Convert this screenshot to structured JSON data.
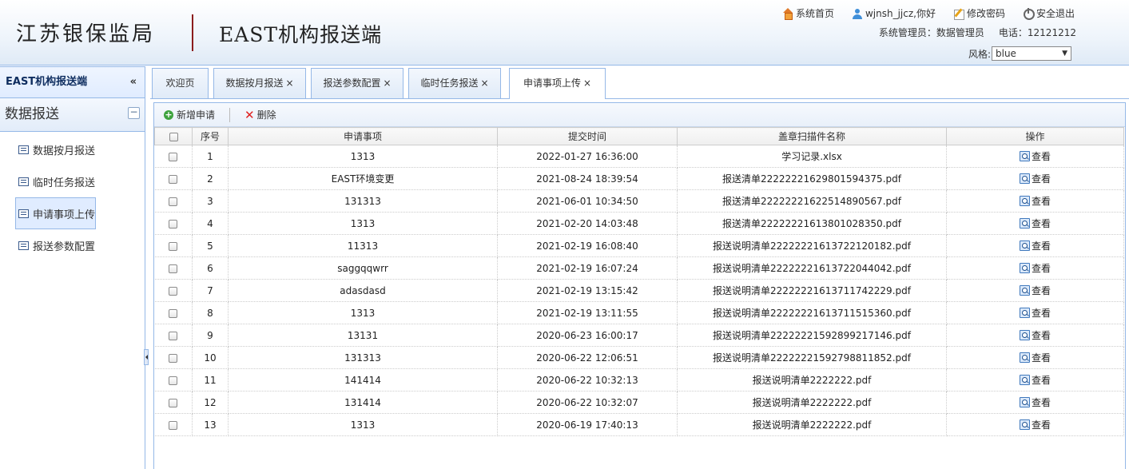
{
  "header": {
    "org_name": "江苏银保监局",
    "system_name": "EAST机构报送端",
    "links": {
      "home": "系统首页",
      "user": "wjnsh_jjcz,你好",
      "change_password": "修改密码",
      "logout": "安全退出"
    },
    "admin_label": "系统管理员：数据管理员",
    "phone_label": "电话：12121212",
    "style_label": "风格:",
    "style_value": "blue"
  },
  "sidebar": {
    "title": "EAST机构报送端",
    "collapse_glyph": "«",
    "section": "数据报送",
    "section_toggle": "−",
    "items": [
      {
        "label": "数据按月报送"
      },
      {
        "label": "临时任务报送"
      },
      {
        "label": "申请事项上传"
      },
      {
        "label": "报送参数配置"
      }
    ]
  },
  "tabs": [
    {
      "label": "欢迎页"
    },
    {
      "label": "数据按月报送"
    },
    {
      "label": "报送参数配置"
    },
    {
      "label": "临时任务报送"
    },
    {
      "label": "申请事项上传"
    }
  ],
  "tab_close_glyph": "×",
  "toolbar": {
    "add_label": "新增申请",
    "delete_label": "删除"
  },
  "table": {
    "headers": [
      "序号",
      "申请事项",
      "提交时间",
      "盖章扫描件名称",
      "操作"
    ],
    "view_label": "查看",
    "rows": [
      {
        "no": "1",
        "item": "1313",
        "time": "2022-01-27 16:36:00",
        "file": "学习记录.xlsx"
      },
      {
        "no": "2",
        "item": "EAST环境变更",
        "time": "2021-08-24 18:39:54",
        "file": "报送清单22222221629801594375.pdf"
      },
      {
        "no": "3",
        "item": "131313",
        "time": "2021-06-01 10:34:50",
        "file": "报送清单22222221622514890567.pdf"
      },
      {
        "no": "4",
        "item": "1313",
        "time": "2021-02-20 14:03:48",
        "file": "报送清单22222221613801028350.pdf"
      },
      {
        "no": "5",
        "item": "11313",
        "time": "2021-02-19 16:08:40",
        "file": "报送说明清单22222221613722120182.pdf"
      },
      {
        "no": "6",
        "item": "saggqqwrr",
        "time": "2021-02-19 16:07:24",
        "file": "报送说明清单22222221613722044042.pdf"
      },
      {
        "no": "7",
        "item": "adasdasd",
        "time": "2021-02-19 13:15:42",
        "file": "报送说明清单22222221613711742229.pdf"
      },
      {
        "no": "8",
        "item": "1313",
        "time": "2021-02-19 13:11:55",
        "file": "报送说明清单22222221613711515360.pdf"
      },
      {
        "no": "9",
        "item": "13131",
        "time": "2020-06-23 16:00:17",
        "file": "报送说明清单22222221592899217146.pdf"
      },
      {
        "no": "10",
        "item": "131313",
        "time": "2020-06-22 12:06:51",
        "file": "报送说明清单22222221592798811852.pdf"
      },
      {
        "no": "11",
        "item": "141414",
        "time": "2020-06-22 10:32:13",
        "file": "报送说明清单2222222.pdf"
      },
      {
        "no": "12",
        "item": "131414",
        "time": "2020-06-22 10:32:07",
        "file": "报送说明清单2222222.pdf"
      },
      {
        "no": "13",
        "item": "1313",
        "time": "2020-06-19 17:40:13",
        "file": "报送说明清单2222222.pdf"
      }
    ]
  }
}
